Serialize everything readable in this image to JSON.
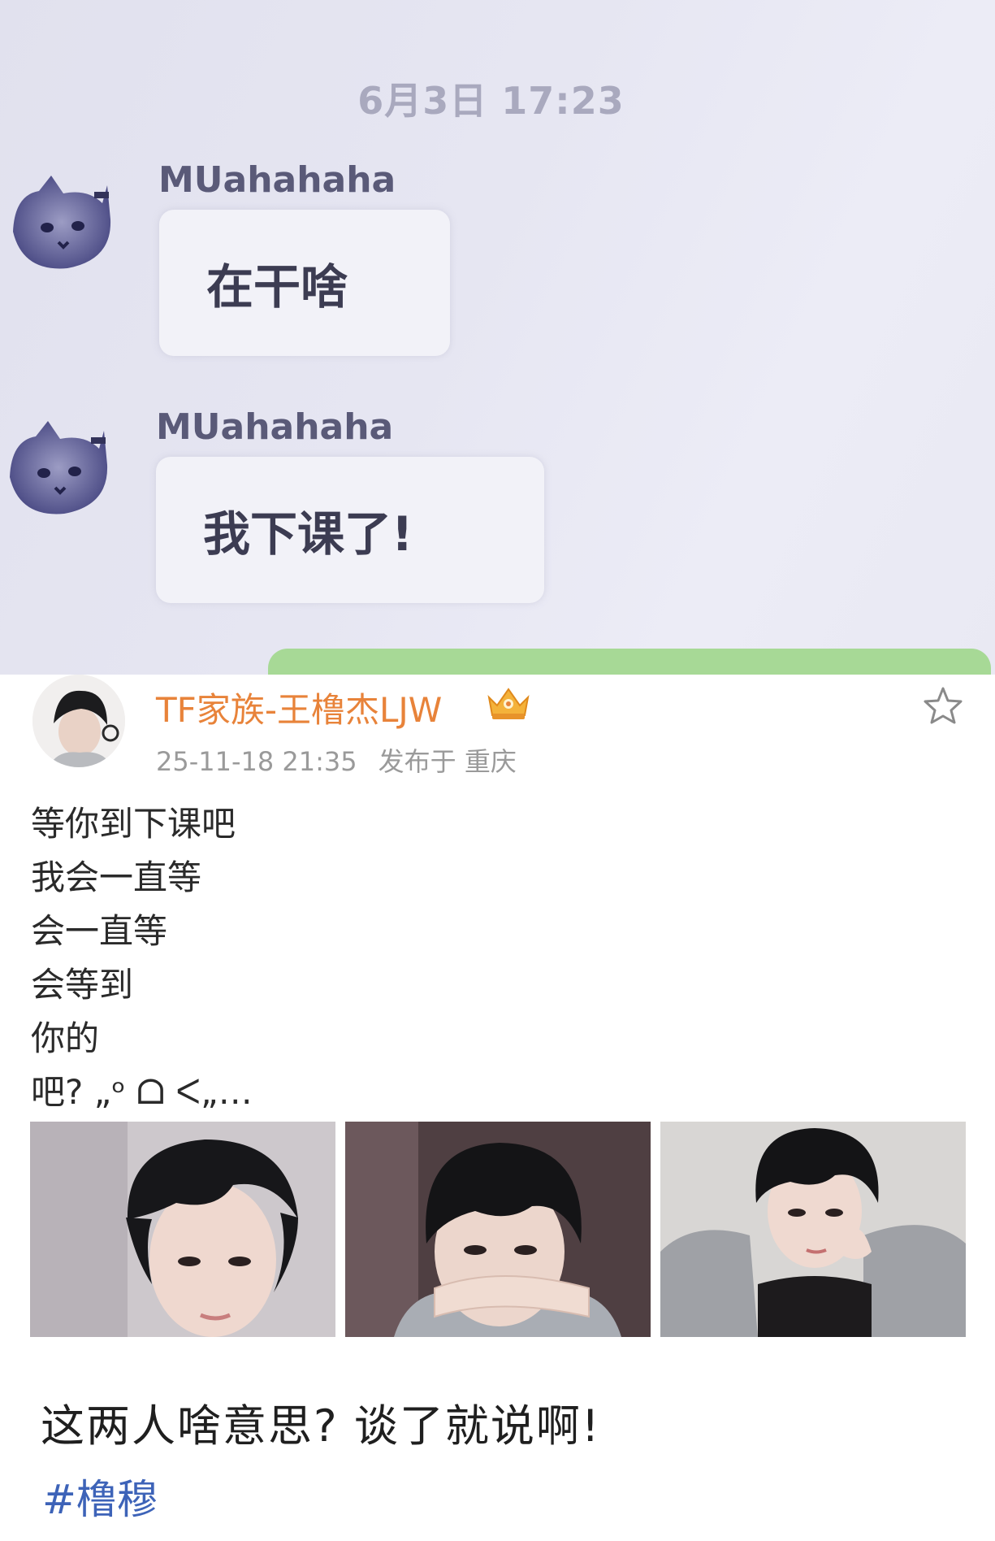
{
  "chat": {
    "timestamp": "6月3日 17:23",
    "messages": [
      {
        "sender": "MUahahaha",
        "text": "在干啥"
      },
      {
        "sender": "MUahahaha",
        "text": "我下课了!"
      }
    ]
  },
  "post": {
    "author": "TF家族-王橹杰LJW",
    "date": "25-11-18 21:35",
    "published_at": "发布于 重庆",
    "lines": [
      "等你到下课吧",
      "我会一直等",
      "会一直等",
      "会等到",
      "你的",
      "吧? „ᵒ ᗝ ᐸ„…"
    ],
    "photos": [
      "photo-1",
      "photo-2",
      "photo-3"
    ]
  },
  "caption": "这两人啥意思? 谈了就说啊!",
  "hashtag": "#橹穆",
  "icons": {
    "favorite": "star-icon",
    "badge": "crown-icon"
  },
  "colors": {
    "author": "#e8833a",
    "hashtag": "#3d63b8",
    "chat_bg": "#e6e6f2",
    "bubble_green": "#a7d996"
  }
}
